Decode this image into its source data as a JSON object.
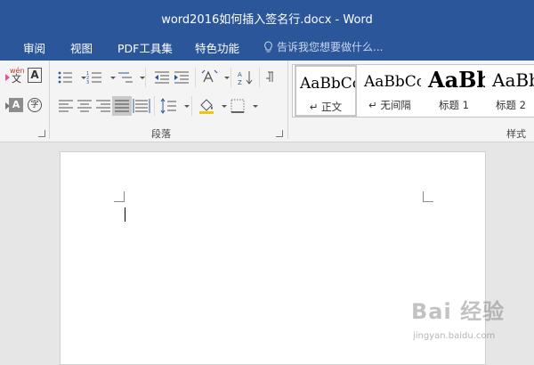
{
  "window": {
    "title": "word2016如何插入签名行.docx - Word"
  },
  "tabs": [
    {
      "label": "审阅"
    },
    {
      "label": "视图"
    },
    {
      "label": "PDF工具集"
    },
    {
      "label": "特色功能"
    }
  ],
  "tell_me": {
    "placeholder": "告诉我您想要做什么..."
  },
  "ribbon": {
    "paragraph_group": {
      "label": "段落"
    },
    "styles_group": {
      "label": "样式"
    },
    "font_glyphs": {
      "phonetic": "wén",
      "phonetic_base": "文",
      "border_char": "A",
      "shade_char": "A",
      "enclose_char": "字"
    },
    "styles": [
      {
        "sample": "AaBbCc",
        "name": "↵ 正文"
      },
      {
        "sample": "AaBbCc",
        "name": "↵ 无间隔"
      },
      {
        "sample": "AaBb",
        "name": "标题 1"
      },
      {
        "sample": "AaBb",
        "name": "标题 2"
      }
    ]
  },
  "watermark": {
    "logo": "Bai 经验",
    "url": "jingyan.baidu.com"
  },
  "colors": {
    "title_bar": "#2b579a",
    "ribbon": "#f4f4f4",
    "workspace": "#e6e6e6"
  }
}
